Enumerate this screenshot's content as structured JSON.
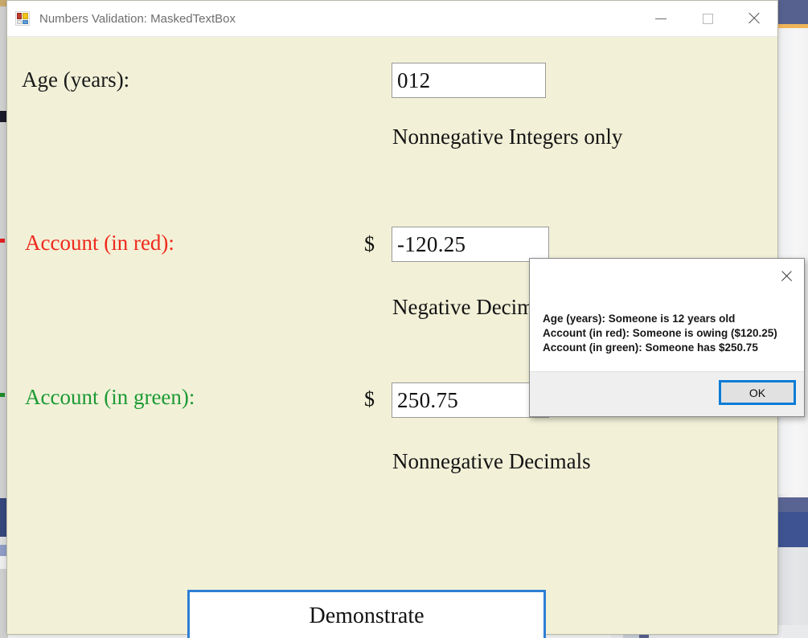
{
  "window": {
    "title": "Numbers Validation: MaskedTextBox",
    "icon": "winforms-app-icon",
    "background_color": "#F2F1D8",
    "controls": {
      "minimize_label": "—",
      "maximize_label": "□",
      "close_label": "✕"
    }
  },
  "form": {
    "fields": [
      {
        "label": "Age (years):",
        "label_color": "#1A1A1A",
        "prefix": "",
        "value": "012",
        "hint": "Nonnegative Integers only"
      },
      {
        "label": "Account (in red):",
        "label_color": "#EF2A1D",
        "prefix": "$",
        "value": "-120.25",
        "hint": "Negative Decimals"
      },
      {
        "label": "Account (in green):",
        "label_color": "#1D9A35",
        "prefix": "$",
        "value": "250.75",
        "hint": "Nonnegative Decimals"
      }
    ],
    "demonstrate_button": {
      "label": "Demonstrate",
      "border_color": "#2E7FD4"
    }
  },
  "dialog": {
    "message": "Age (years): Someone is 12 years old\nAccount (in red): Someone is owing ($120.25)\nAccount (in green): Someone has $250.75",
    "message_lines": [
      "Age (years): Someone is 12 years old",
      "Account (in red): Someone is owing ($120.25)",
      "Account (in green): Someone has $250.75"
    ],
    "ok_label": "OK",
    "close_label": "✕",
    "ok_focus_color": "#0A7CD6"
  }
}
